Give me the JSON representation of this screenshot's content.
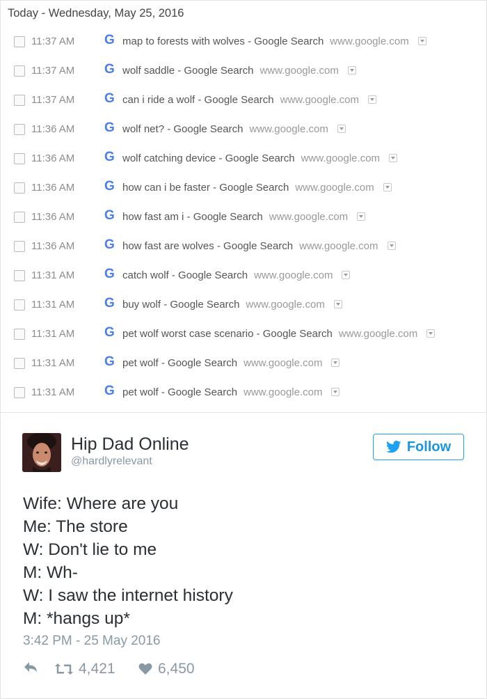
{
  "history": {
    "date_heading": "Today - Wednesday, May 25, 2016",
    "favicon_letter": "G",
    "entries": [
      {
        "time": "11:37 AM",
        "title": "map to forests with wolves - Google Search",
        "domain": "www.google.com"
      },
      {
        "time": "11:37 AM",
        "title": "wolf saddle - Google Search",
        "domain": "www.google.com"
      },
      {
        "time": "11:37 AM",
        "title": "can i ride a wolf - Google Search",
        "domain": "www.google.com"
      },
      {
        "time": "11:36 AM",
        "title": "wolf net? - Google Search",
        "domain": "www.google.com"
      },
      {
        "time": "11:36 AM",
        "title": "wolf catching device - Google Search",
        "domain": "www.google.com"
      },
      {
        "time": "11:36 AM",
        "title": "how can i be faster - Google Search",
        "domain": "www.google.com"
      },
      {
        "time": "11:36 AM",
        "title": "how fast am i - Google Search",
        "domain": "www.google.com"
      },
      {
        "time": "11:36 AM",
        "title": "how fast are wolves - Google Search",
        "domain": "www.google.com"
      },
      {
        "time": "11:31 AM",
        "title": "catch wolf - Google Search",
        "domain": "www.google.com"
      },
      {
        "time": "11:31 AM",
        "title": "buy wolf - Google Search",
        "domain": "www.google.com"
      },
      {
        "time": "11:31 AM",
        "title": "pet wolf worst case scenario - Google Search",
        "domain": "www.google.com"
      },
      {
        "time": "11:31 AM",
        "title": "pet wolf - Google Search",
        "domain": "www.google.com"
      },
      {
        "time": "11:31 AM",
        "title": "pet wolf - Google Search",
        "domain": "www.google.com"
      }
    ]
  },
  "tweet": {
    "author_name": "Hip Dad Online",
    "handle": "@hardlyrelevant",
    "follow_label": "Follow",
    "lines": [
      "Wife: Where are you",
      "Me: The store",
      "W: Don't lie to me",
      "M: Wh-",
      "W: I saw the internet history",
      "M: *hangs up*"
    ],
    "timestamp": "3:42 PM - 25 May 2016",
    "retweets": "4,421",
    "likes": "6,450",
    "icons": {
      "reply": "reply-icon",
      "retweet": "retweet-icon",
      "like": "heart-icon",
      "bird": "twitter-bird-icon"
    },
    "colors": {
      "accent": "#1da1f2",
      "muted": "#8899a6"
    }
  },
  "colors": {
    "google_blue": "#4a7ee8",
    "history_text": "#555555",
    "history_muted": "#999999"
  }
}
